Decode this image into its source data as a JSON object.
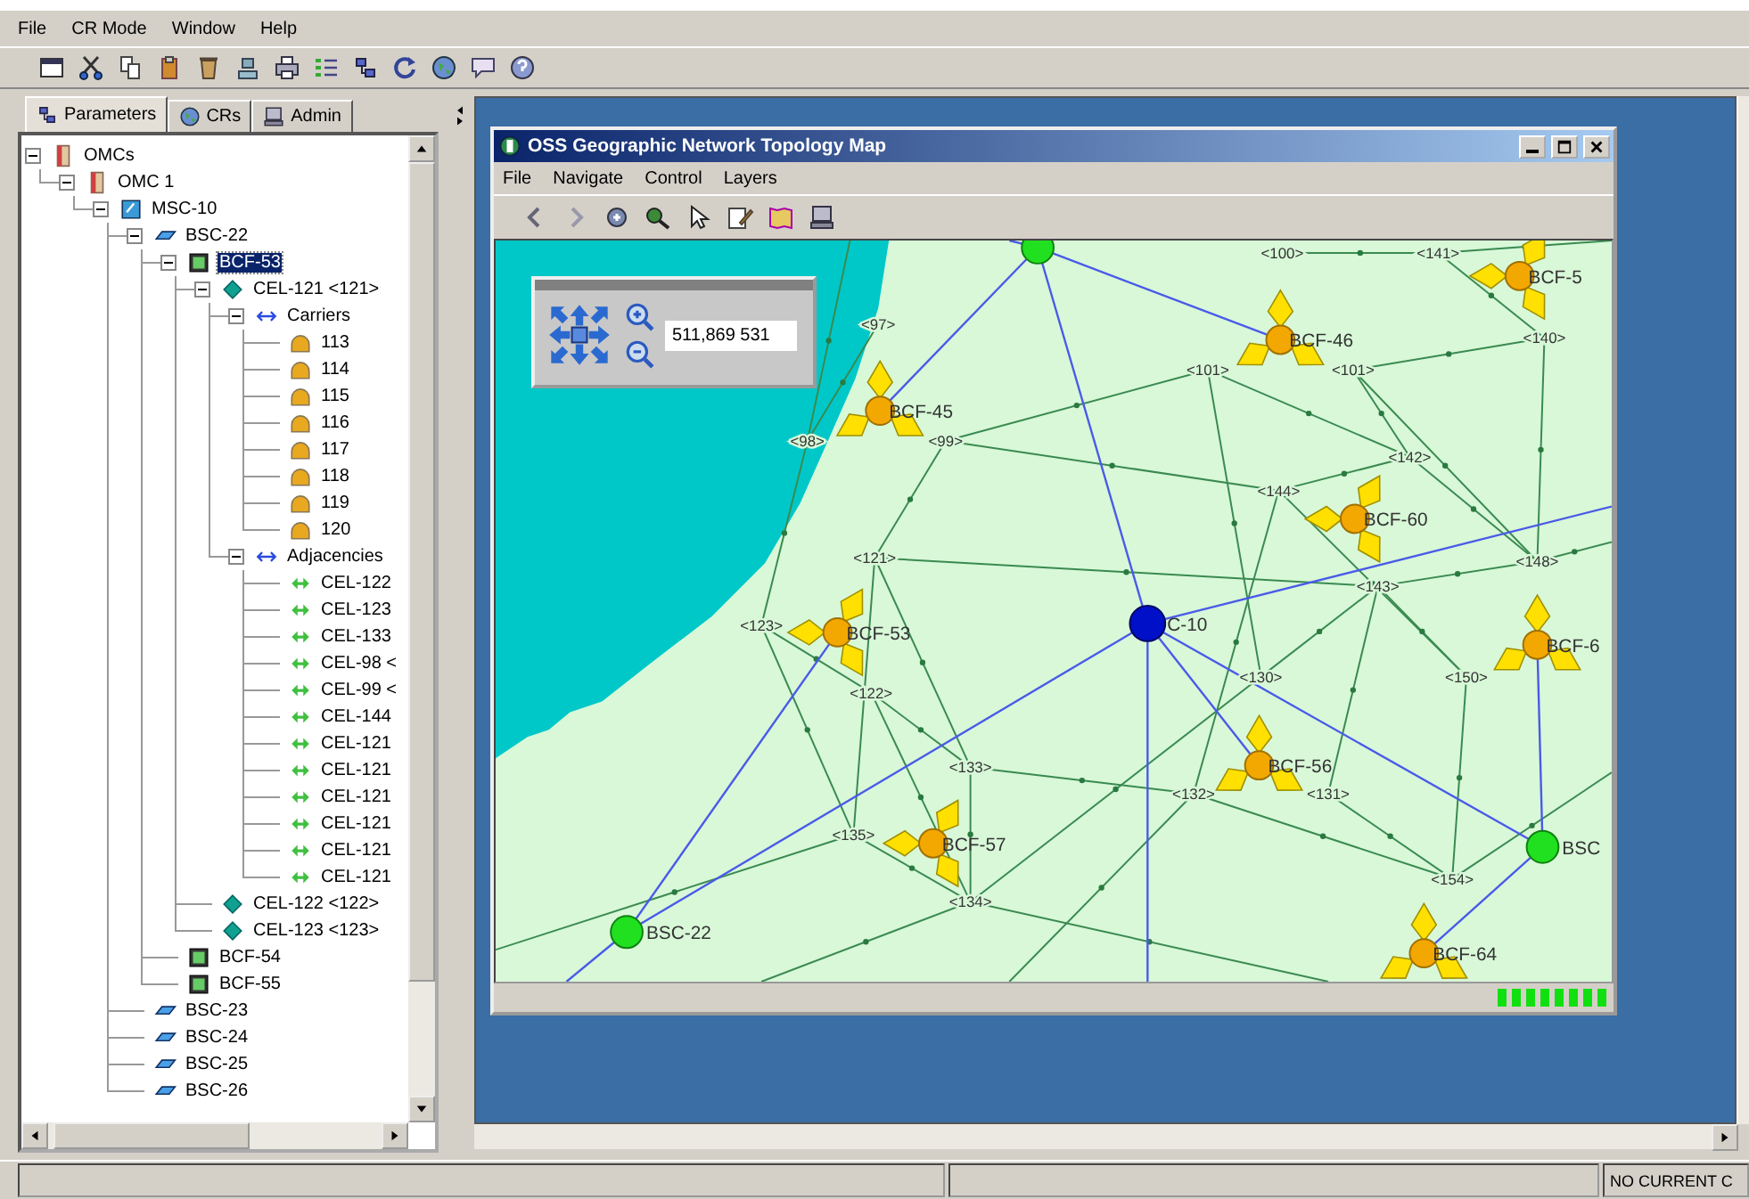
{
  "menu": [
    {
      "label": "File"
    },
    {
      "label": "CR Mode"
    },
    {
      "label": "Window"
    },
    {
      "label": "Help"
    }
  ],
  "tabs": [
    {
      "label": "Parameters",
      "selected": true
    },
    {
      "label": "CRs",
      "selected": false
    },
    {
      "label": "Admin",
      "selected": false
    }
  ],
  "tree": [
    {
      "label": "OMCs",
      "kind": "omc",
      "selected": false,
      "expanded": true,
      "children": [
        {
          "label": "OMC 1",
          "kind": "omc",
          "selected": false,
          "expanded": true,
          "children": [
            {
              "label": "MSC-10",
              "kind": "msc",
              "selected": false,
              "expanded": true,
              "children": [
                {
                  "label": "BSC-22",
                  "kind": "bsc",
                  "selected": false,
                  "expanded": true,
                  "children": [
                    {
                      "label": "BCF-53",
                      "kind": "bcf",
                      "selected": true,
                      "expanded": true,
                      "children": [
                        {
                          "label": "CEL-121 <121>",
                          "kind": "cell",
                          "selected": false,
                          "expanded": true,
                          "children": [
                            {
                              "label": "Carriers",
                              "kind": "group",
                              "selected": false,
                              "expanded": true,
                              "children": [
                                {
                                  "label": "113",
                                  "kind": "carrier",
                                  "selected": false
                                },
                                {
                                  "label": "114",
                                  "kind": "carrier",
                                  "selected": false
                                },
                                {
                                  "label": "115",
                                  "kind": "carrier",
                                  "selected": false
                                },
                                {
                                  "label": "116",
                                  "kind": "carrier",
                                  "selected": false
                                },
                                {
                                  "label": "117",
                                  "kind": "carrier",
                                  "selected": false
                                },
                                {
                                  "label": "118",
                                  "kind": "carrier",
                                  "selected": false
                                },
                                {
                                  "label": "119",
                                  "kind": "carrier",
                                  "selected": false
                                },
                                {
                                  "label": "120",
                                  "kind": "carrier",
                                  "selected": false
                                }
                              ]
                            },
                            {
                              "label": "Adjacencies",
                              "kind": "group",
                              "selected": false,
                              "expanded": true,
                              "children": [
                                {
                                  "label": "CEL-122",
                                  "kind": "adjacency",
                                  "selected": false
                                },
                                {
                                  "label": "CEL-123",
                                  "kind": "adjacency",
                                  "selected": false
                                },
                                {
                                  "label": "CEL-133",
                                  "kind": "adjacency",
                                  "selected": false
                                },
                                {
                                  "label": "CEL-98 <",
                                  "kind": "adjacency",
                                  "selected": false
                                },
                                {
                                  "label": "CEL-99 <",
                                  "kind": "adjacency",
                                  "selected": false
                                },
                                {
                                  "label": "CEL-144",
                                  "kind": "adjacency",
                                  "selected": false
                                },
                                {
                                  "label": "CEL-121",
                                  "kind": "adjacency",
                                  "selected": false
                                },
                                {
                                  "label": "CEL-121",
                                  "kind": "adjacency",
                                  "selected": false
                                },
                                {
                                  "label": "CEL-121",
                                  "kind": "adjacency",
                                  "selected": false
                                },
                                {
                                  "label": "CEL-121",
                                  "kind": "adjacency",
                                  "selected": false
                                },
                                {
                                  "label": "CEL-121",
                                  "kind": "adjacency",
                                  "selected": false
                                },
                                {
                                  "label": "CEL-121",
                                  "kind": "adjacency",
                                  "selected": false
                                }
                              ]
                            }
                          ]
                        },
                        {
                          "label": "CEL-122 <122>",
                          "kind": "cell",
                          "selected": false
                        },
                        {
                          "label": "CEL-123 <123>",
                          "kind": "cell",
                          "selected": false
                        }
                      ]
                    },
                    {
                      "label": "BCF-54",
                      "kind": "bcf",
                      "selected": false
                    },
                    {
                      "label": "BCF-55",
                      "kind": "bcf",
                      "selected": false
                    }
                  ]
                },
                {
                  "label": "BSC-23",
                  "kind": "bsc",
                  "selected": false
                },
                {
                  "label": "BSC-24",
                  "kind": "bsc",
                  "selected": false
                },
                {
                  "label": "BSC-25",
                  "kind": "bsc",
                  "selected": false
                },
                {
                  "label": "BSC-26",
                  "kind": "bsc",
                  "selected": false
                }
              ]
            }
          ]
        }
      ]
    }
  ],
  "map_window": {
    "title": "OSS Geographic Network Topology Map",
    "menu": [
      {
        "label": "File"
      },
      {
        "label": "Navigate"
      },
      {
        "label": "Control"
      },
      {
        "label": "Layers"
      }
    ],
    "zoom_panel": {
      "coordinates": "511,869 531"
    },
    "sites": [
      {
        "kind": "bsc"
      },
      {
        "kind": "msc",
        "label": "C-10"
      },
      {
        "kind": "bsc",
        "label": "BSC-22"
      },
      {
        "kind": "bsc",
        "label": "BSC"
      },
      {
        "kind": "bcf",
        "label": "BCF-46"
      },
      {
        "kind": "bcf",
        "label": "BCF-45"
      },
      {
        "kind": "bcf",
        "label": "BCF-60"
      },
      {
        "kind": "bcf",
        "label": "BCF-53"
      },
      {
        "kind": "bcf",
        "label": "BCF-56"
      },
      {
        "kind": "bcf",
        "label": "BCF-57"
      },
      {
        "kind": "bcf",
        "label": "BCF-64"
      },
      {
        "kind": "bcf",
        "label": "BCF-5"
      },
      {
        "kind": "bcf",
        "label": "BCF-6"
      }
    ],
    "cell_labels": [
      "<97>",
      "<98>",
      "<99>",
      "<100>",
      "<101>",
      "<101>",
      "<141>",
      "<140>",
      "<142>",
      "<144>",
      "<143>",
      "<148>",
      "<121>",
      "<123>",
      "<122>",
      "<130>",
      "<150>",
      "<133>",
      "<132>",
      "<131>",
      "<135>",
      "<134>",
      "<154>"
    ]
  },
  "status_bar": {
    "message": "NO CURRENT C"
  }
}
